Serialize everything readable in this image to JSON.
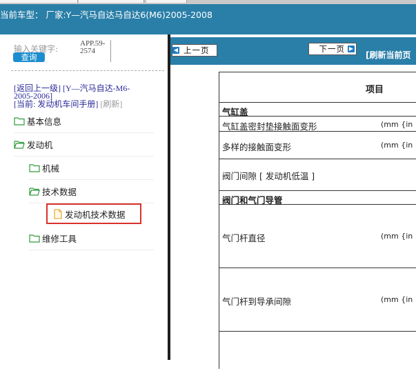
{
  "header": {
    "current_model": "当前车型：  厂家:Y—汽马自达马自达6(M6)2005-2008"
  },
  "sidebar": {
    "keyword_label": "输入关键字:",
    "keyword_value_line1": "APP.59-",
    "keyword_value_line2": "2574",
    "search_button": "查询",
    "back_link": "[返回上一级]",
    "path_line1": "[Y—汽马自达-M6-",
    "path_line2": "2005-2006]",
    "current_label": "[当前: 发动机车间手册]",
    "refresh_link": "[刷新]",
    "items": [
      {
        "label": "基本信息"
      },
      {
        "label": "发动机"
      },
      {
        "label": "机械"
      },
      {
        "label": "技术数据"
      },
      {
        "label": "发动机技术数据"
      },
      {
        "label": "维修工具"
      }
    ]
  },
  "toolbar": {
    "prev_label": "上一页",
    "next_label": "下一页",
    "refresh_label": "[刷新当前页"
  },
  "table": {
    "header": "项目",
    "rows": [
      {
        "text": "气缸盖",
        "unit": ""
      },
      {
        "text": "气缸盖密封垫接触面变形",
        "unit": "(mm {in"
      },
      {
        "text": "多样的接触面变形",
        "unit": "(mm {in"
      },
      {
        "text": "阀门间隙 [ 发动机低温 ]",
        "unit": ""
      },
      {
        "text": "阀门和气门导管",
        "unit": ""
      },
      {
        "text": "气门杆直径",
        "unit": "(mm {in"
      },
      {
        "text": "气门杆到导承间隙",
        "unit": "(mm {in"
      }
    ]
  },
  "colors": {
    "accent": "#2a7fa8",
    "selected_border": "#d9312c",
    "button_blue": "#1c8ecf"
  }
}
